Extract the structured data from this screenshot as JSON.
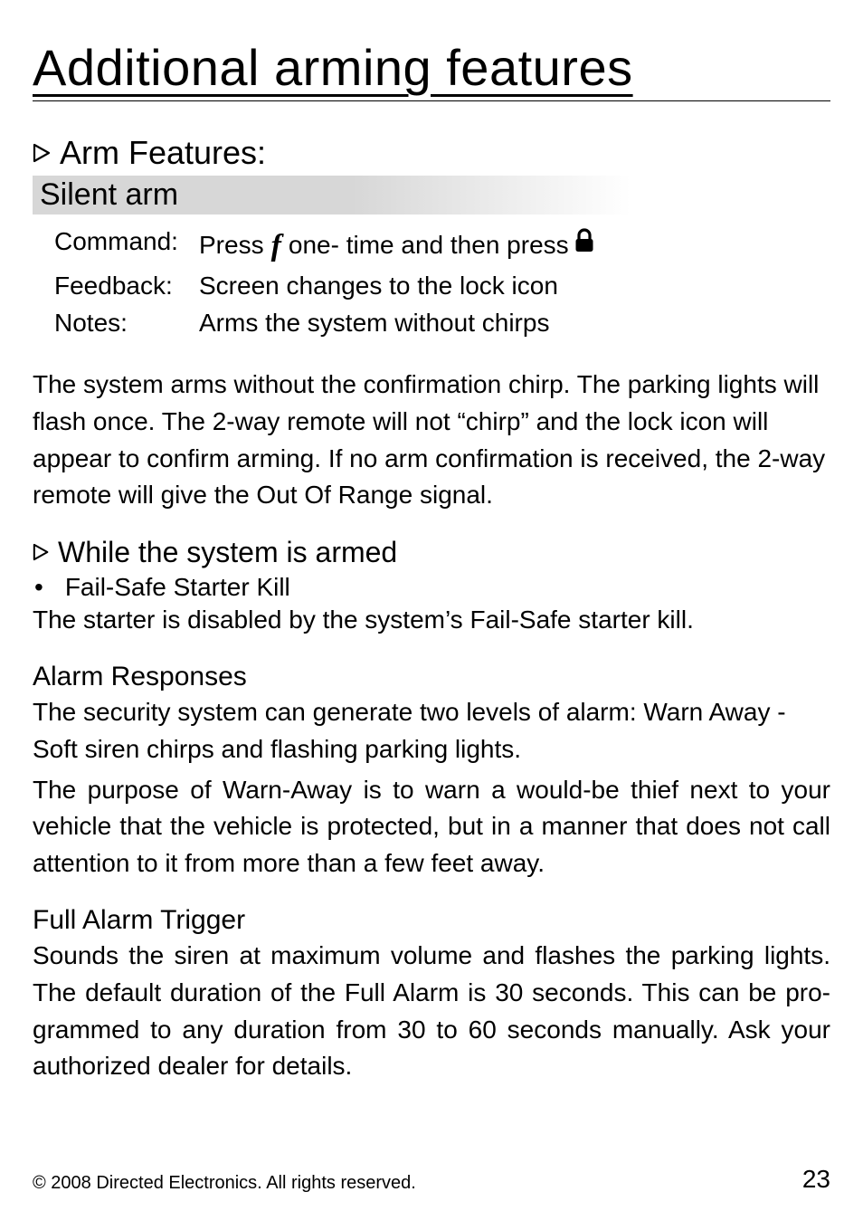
{
  "title": "Additional arming features",
  "section_arm_features": "Arm Features:",
  "silent_arm_label": "Silent arm",
  "rows": {
    "command_label": "Command",
    "command_pre": "Press",
    "command_mid": "one- time and then press",
    "feedback_label": "Feedback",
    "feedback_val": "Screen changes to the lock icon",
    "notes_label": "Notes",
    "notes_val": "Arms the system without chirps"
  },
  "para1": "The system arms without the confirmation chirp. The parking lights will flash once. The 2-way remote will not “chirp”  and the lock icon will appear to confirm arming. If no arm confirmation is received, the 2-way remote will give the Out Of Range signal.",
  "section_while_armed": "While the system is armed",
  "bullet1": "Fail-Safe Starter Kill",
  "para2": "The starter is disabled by the system’s Fail-Safe starter kill.",
  "alarm_responses_head": "Alarm Responses",
  "alarm_responses_p1": "The security system can generate two levels of alarm: Warn Away - Soft siren chirps and flashing parking lights.",
  "alarm_responses_p2": "The purpose of Warn-Away is to warn a would-be thief next to your vehicle that the vehicle is protected, but in a manner that does not call attention to it from more than a few feet away.",
  "full_alarm_head": "Full Alarm Trigger",
  "full_alarm_p": "Sounds the siren at maximum volume and flashes the parking lights. The default duration of the Full Alarm is 30 seconds. This can be pro-grammed to any duration from 30 to 60 seconds manually. Ask your authorized dealer for details.",
  "footer_copy": "© 2008 Directed Electronics. All rights reserved.",
  "page_number": "23"
}
